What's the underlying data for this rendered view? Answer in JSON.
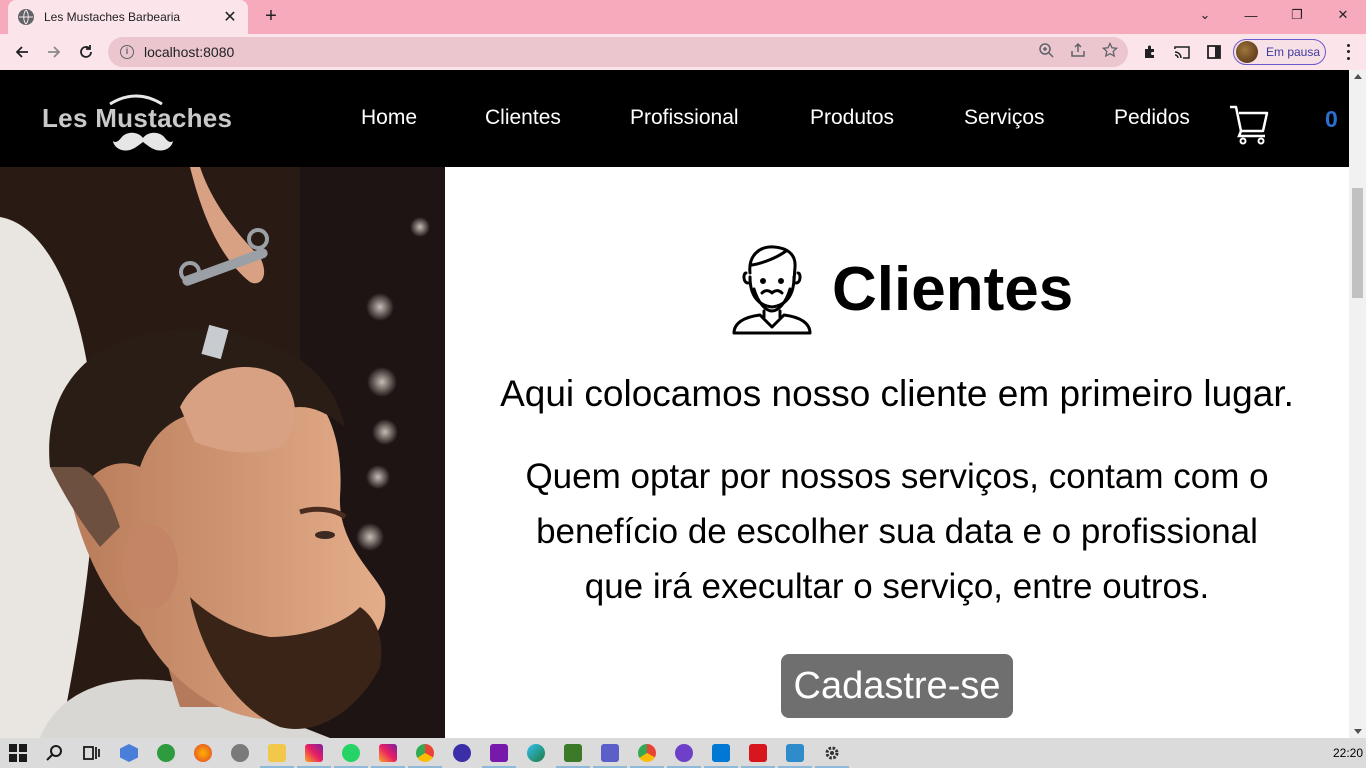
{
  "browser": {
    "tab_title": "Les Mustaches Barbearia",
    "tab_close": "✕",
    "new_tab": "+",
    "url": "localhost:8080",
    "info_glyph": "i",
    "profile_label": "Em pausa",
    "window_controls": [
      "⌄",
      "—",
      "❐",
      "✕"
    ],
    "theme_color": "#f8aabd"
  },
  "site": {
    "logo_text": "Les Mustaches",
    "nav": [
      "Home",
      "Clientes",
      "Profissional",
      "Produtos",
      "Serviços",
      "Pedidos"
    ],
    "cart_count": "0",
    "cart_icon": "shopping-cart-icon",
    "accent_color": "#2b6fd1"
  },
  "main": {
    "title": "Clientes",
    "title_icon": "bearded-man-icon",
    "intro": "Aqui colocamos nosso cliente em primeiro lugar.",
    "desc_lines": [
      "Quem optar por nossos serviços, contam com o",
      "benefício de escolher sua data e o profissional",
      "que irá execultar o serviço, entre outros."
    ],
    "cta_label": "Cadastre-se"
  },
  "taskbar": {
    "clock": "22:20",
    "apps": [
      "start-icon",
      "search-icon",
      "task-view-icon",
      "app-icon",
      "app-icon",
      "firefox-icon",
      "whatsapp-icon",
      "file-explorer-icon",
      "instagram-icon",
      "whatsapp-icon",
      "instagram-icon",
      "chrome-icon",
      "app-icon",
      "onenote-icon",
      "edge-icon",
      "app-icon",
      "teams-icon",
      "chrome-icon",
      "github-icon",
      "vscode-icon",
      "acrobat-icon",
      "app-icon",
      "settings-icon"
    ]
  }
}
